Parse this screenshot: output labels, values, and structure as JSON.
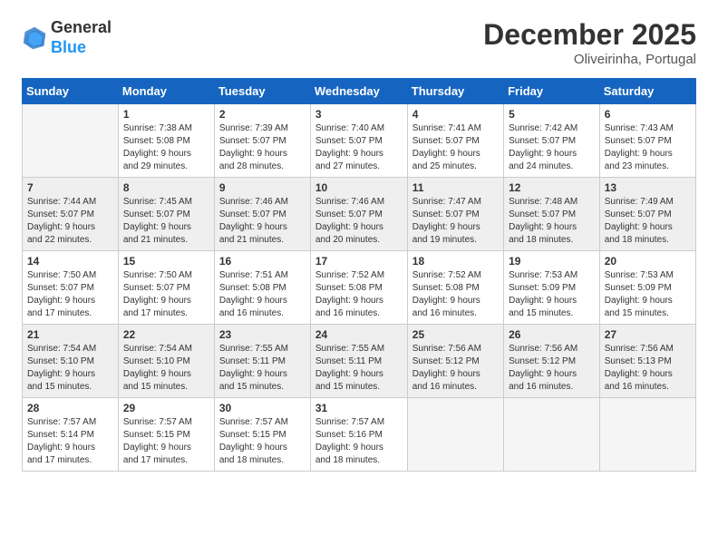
{
  "header": {
    "logo_general": "General",
    "logo_blue": "Blue",
    "month_title": "December 2025",
    "location": "Oliveirinha, Portugal"
  },
  "calendar": {
    "headers": [
      "Sunday",
      "Monday",
      "Tuesday",
      "Wednesday",
      "Thursday",
      "Friday",
      "Saturday"
    ],
    "rows": [
      [
        {
          "num": "",
          "info": ""
        },
        {
          "num": "1",
          "info": "Sunrise: 7:38 AM\nSunset: 5:08 PM\nDaylight: 9 hours\nand 29 minutes."
        },
        {
          "num": "2",
          "info": "Sunrise: 7:39 AM\nSunset: 5:07 PM\nDaylight: 9 hours\nand 28 minutes."
        },
        {
          "num": "3",
          "info": "Sunrise: 7:40 AM\nSunset: 5:07 PM\nDaylight: 9 hours\nand 27 minutes."
        },
        {
          "num": "4",
          "info": "Sunrise: 7:41 AM\nSunset: 5:07 PM\nDaylight: 9 hours\nand 25 minutes."
        },
        {
          "num": "5",
          "info": "Sunrise: 7:42 AM\nSunset: 5:07 PM\nDaylight: 9 hours\nand 24 minutes."
        },
        {
          "num": "6",
          "info": "Sunrise: 7:43 AM\nSunset: 5:07 PM\nDaylight: 9 hours\nand 23 minutes."
        }
      ],
      [
        {
          "num": "7",
          "info": "Sunrise: 7:44 AM\nSunset: 5:07 PM\nDaylight: 9 hours\nand 22 minutes."
        },
        {
          "num": "8",
          "info": "Sunrise: 7:45 AM\nSunset: 5:07 PM\nDaylight: 9 hours\nand 21 minutes."
        },
        {
          "num": "9",
          "info": "Sunrise: 7:46 AM\nSunset: 5:07 PM\nDaylight: 9 hours\nand 21 minutes."
        },
        {
          "num": "10",
          "info": "Sunrise: 7:46 AM\nSunset: 5:07 PM\nDaylight: 9 hours\nand 20 minutes."
        },
        {
          "num": "11",
          "info": "Sunrise: 7:47 AM\nSunset: 5:07 PM\nDaylight: 9 hours\nand 19 minutes."
        },
        {
          "num": "12",
          "info": "Sunrise: 7:48 AM\nSunset: 5:07 PM\nDaylight: 9 hours\nand 18 minutes."
        },
        {
          "num": "13",
          "info": "Sunrise: 7:49 AM\nSunset: 5:07 PM\nDaylight: 9 hours\nand 18 minutes."
        }
      ],
      [
        {
          "num": "14",
          "info": "Sunrise: 7:50 AM\nSunset: 5:07 PM\nDaylight: 9 hours\nand 17 minutes."
        },
        {
          "num": "15",
          "info": "Sunrise: 7:50 AM\nSunset: 5:07 PM\nDaylight: 9 hours\nand 17 minutes."
        },
        {
          "num": "16",
          "info": "Sunrise: 7:51 AM\nSunset: 5:08 PM\nDaylight: 9 hours\nand 16 minutes."
        },
        {
          "num": "17",
          "info": "Sunrise: 7:52 AM\nSunset: 5:08 PM\nDaylight: 9 hours\nand 16 minutes."
        },
        {
          "num": "18",
          "info": "Sunrise: 7:52 AM\nSunset: 5:08 PM\nDaylight: 9 hours\nand 16 minutes."
        },
        {
          "num": "19",
          "info": "Sunrise: 7:53 AM\nSunset: 5:09 PM\nDaylight: 9 hours\nand 15 minutes."
        },
        {
          "num": "20",
          "info": "Sunrise: 7:53 AM\nSunset: 5:09 PM\nDaylight: 9 hours\nand 15 minutes."
        }
      ],
      [
        {
          "num": "21",
          "info": "Sunrise: 7:54 AM\nSunset: 5:10 PM\nDaylight: 9 hours\nand 15 minutes."
        },
        {
          "num": "22",
          "info": "Sunrise: 7:54 AM\nSunset: 5:10 PM\nDaylight: 9 hours\nand 15 minutes."
        },
        {
          "num": "23",
          "info": "Sunrise: 7:55 AM\nSunset: 5:11 PM\nDaylight: 9 hours\nand 15 minutes."
        },
        {
          "num": "24",
          "info": "Sunrise: 7:55 AM\nSunset: 5:11 PM\nDaylight: 9 hours\nand 15 minutes."
        },
        {
          "num": "25",
          "info": "Sunrise: 7:56 AM\nSunset: 5:12 PM\nDaylight: 9 hours\nand 16 minutes."
        },
        {
          "num": "26",
          "info": "Sunrise: 7:56 AM\nSunset: 5:12 PM\nDaylight: 9 hours\nand 16 minutes."
        },
        {
          "num": "27",
          "info": "Sunrise: 7:56 AM\nSunset: 5:13 PM\nDaylight: 9 hours\nand 16 minutes."
        }
      ],
      [
        {
          "num": "28",
          "info": "Sunrise: 7:57 AM\nSunset: 5:14 PM\nDaylight: 9 hours\nand 17 minutes."
        },
        {
          "num": "29",
          "info": "Sunrise: 7:57 AM\nSunset: 5:15 PM\nDaylight: 9 hours\nand 17 minutes."
        },
        {
          "num": "30",
          "info": "Sunrise: 7:57 AM\nSunset: 5:15 PM\nDaylight: 9 hours\nand 18 minutes."
        },
        {
          "num": "31",
          "info": "Sunrise: 7:57 AM\nSunset: 5:16 PM\nDaylight: 9 hours\nand 18 minutes."
        },
        {
          "num": "",
          "info": ""
        },
        {
          "num": "",
          "info": ""
        },
        {
          "num": "",
          "info": ""
        }
      ]
    ]
  }
}
